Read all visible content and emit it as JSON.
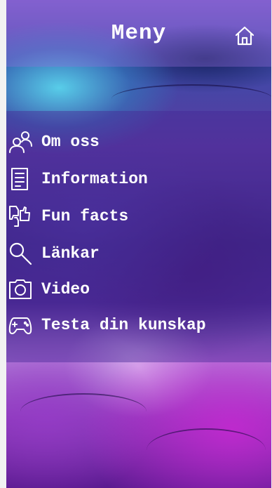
{
  "header": {
    "title": "Meny",
    "home_icon": "home-icon"
  },
  "menu": {
    "items": [
      {
        "label": "Om oss",
        "icon": "users-icon"
      },
      {
        "label": "Information",
        "icon": "document-icon"
      },
      {
        "label": "Fun facts",
        "icon": "thumbs-icon"
      },
      {
        "label": "Länkar",
        "icon": "search-icon"
      },
      {
        "label": "Video",
        "icon": "camera-icon"
      },
      {
        "label": "Testa din kunskap",
        "icon": "gamepad-icon"
      }
    ]
  },
  "colors": {
    "text": "#ffffff",
    "header_tint": "#966edc",
    "background_primary": "#4a2890"
  }
}
